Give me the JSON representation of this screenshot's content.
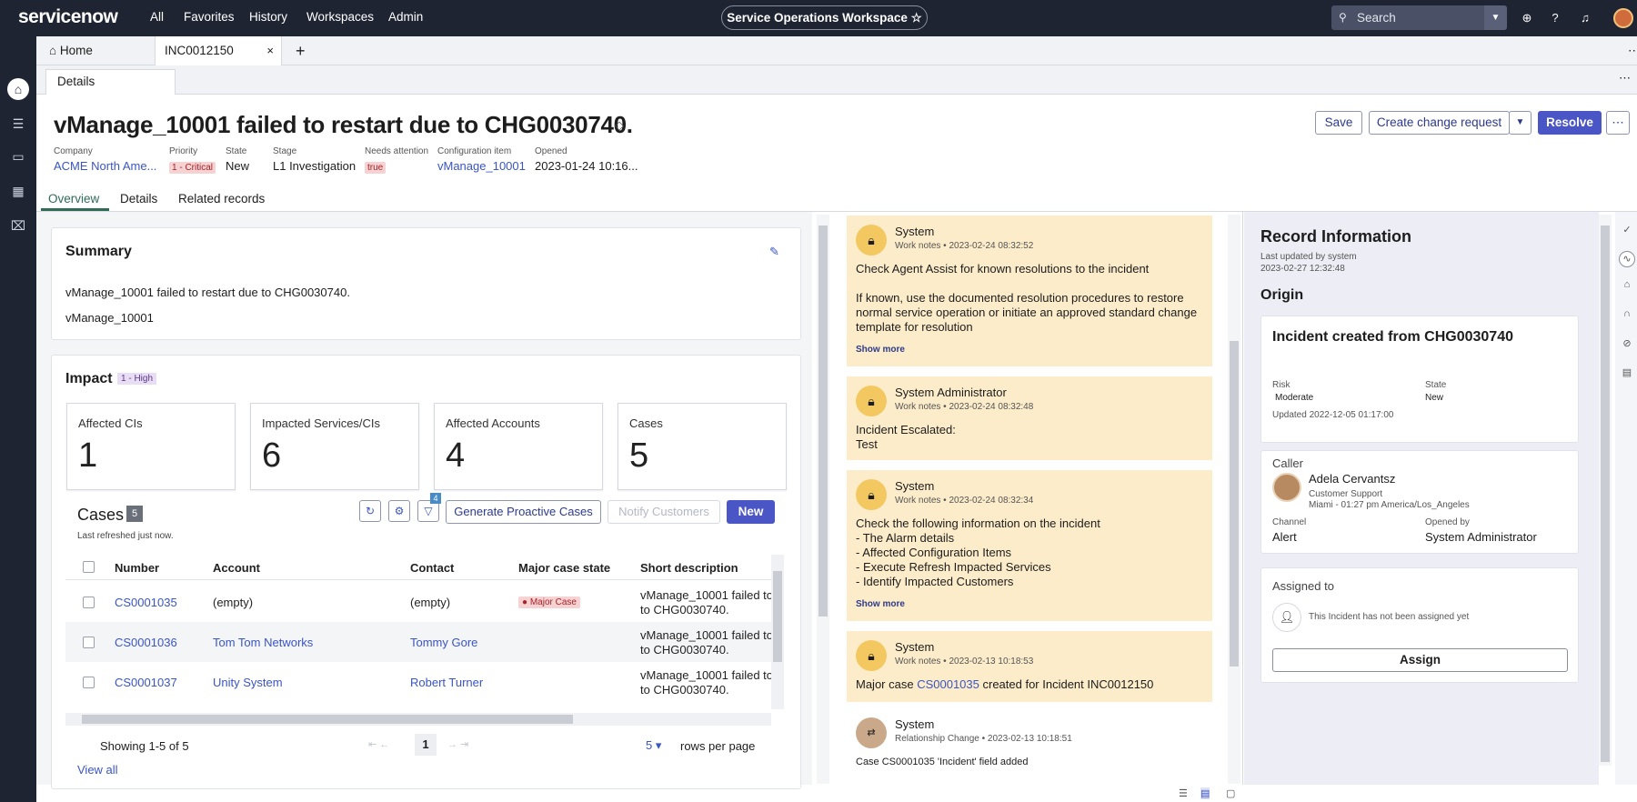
{
  "topnav": {
    "logo": "servicenow",
    "links": [
      "All",
      "Favorites",
      "History",
      "Workspaces",
      "Admin"
    ],
    "workspace": "Service Operations Workspace",
    "search_placeholder": "Search"
  },
  "tabs": {
    "home": "Home",
    "record": "INC0012150",
    "details": "Details"
  },
  "record": {
    "title": "vManage_10001 failed to restart due to CHG0030740.",
    "buttons": {
      "save": "Save",
      "create_change": "Create change request",
      "resolve": "Resolve"
    },
    "meta": {
      "company_label": "Company",
      "company": "ACME North Ame...",
      "priority_label": "Priority",
      "priority": "1 - Critical",
      "state_label": "State",
      "state": "New",
      "stage_label": "Stage",
      "stage": "L1 Investigation",
      "attention_label": "Needs attention",
      "attention": "true",
      "ci_label": "Configuration item",
      "ci": "vManage_10001",
      "opened_label": "Opened",
      "opened": "2023-01-24 10:16..."
    },
    "page_tabs": [
      "Overview",
      "Details",
      "Related records"
    ]
  },
  "summary": {
    "title": "Summary",
    "line1": "vManage_10001 failed to restart due to CHG0030740.",
    "line2": "vManage_10001"
  },
  "impact": {
    "title": "Impact",
    "badge": "1 - High",
    "metrics": [
      {
        "label": "Affected CIs",
        "value": "1"
      },
      {
        "label": "Impacted Services/CIs",
        "value": "6"
      },
      {
        "label": "Affected Accounts",
        "value": "4"
      },
      {
        "label": "Cases",
        "value": "5"
      }
    ]
  },
  "cases": {
    "title": "Cases",
    "count": "5",
    "refreshed": "Last refreshed just now.",
    "filter_count": "4",
    "generate_btn": "Generate Proactive Cases",
    "notify_btn": "Notify Customers",
    "new_btn": "New",
    "columns": [
      "Number",
      "Account",
      "Contact",
      "Major case state",
      "Short description"
    ],
    "rows": [
      {
        "number": "CS0001035",
        "account": "(empty)",
        "contact": "(empty)",
        "state": "Major Case",
        "desc1": "vManage_10001 failed to",
        "desc2": "to CHG0030740."
      },
      {
        "number": "CS0001036",
        "account": "Tom Tom Networks",
        "contact": "Tommy Gore",
        "state": "",
        "desc1": "vManage_10001 failed to",
        "desc2": "to CHG0030740."
      },
      {
        "number": "CS0001037",
        "account": "Unity System",
        "contact": "Robert Turner",
        "state": "",
        "desc1": "vManage_10001 failed to",
        "desc2": "to CHG0030740."
      }
    ],
    "showing": "Showing 1-5 of 5",
    "page": "1",
    "per_page": "5",
    "per_page_label": "rows per page",
    "view_all": "View all"
  },
  "activity": [
    {
      "name": "System",
      "type": "Work notes",
      "time": "2023-02-24 08:32:52",
      "body": [
        "Check Agent Assist for known resolutions to the incident",
        "",
        "If known, use the documented resolution procedures to restore",
        "normal service operation or initiate an approved standard change",
        "template for resolution"
      ],
      "more": "Show more"
    },
    {
      "name": "System Administrator",
      "type": "Work notes",
      "time": "2023-02-24 08:32:48",
      "body": [
        "Incident Escalated:",
        "Test"
      ]
    },
    {
      "name": "System",
      "type": "Work notes",
      "time": "2023-02-24 08:32:34",
      "body": [
        "Check the following information on the incident",
        "- The Alarm details",
        "- Affected Configuration Items",
        "- Execute Refresh Impacted Services",
        "- Identify Impacted Customers"
      ],
      "more": "Show more"
    },
    {
      "name": "System",
      "type": "Work notes",
      "time": "2023-02-13 10:18:53",
      "body_pre": "Major case ",
      "body_link": "CS0001035",
      "body_post": " created for Incident INC0012150"
    },
    {
      "name": "System",
      "type": "Relationship Change",
      "time": "2023-02-13 10:18:51",
      "body": [
        "Case CS0001035 'Incident' field added"
      ]
    }
  ],
  "record_info": {
    "title": "Record Information",
    "updated_by": "Last updated by system",
    "updated_at": "2023-02-27 12:32:48",
    "origin": "Origin",
    "origin_card": {
      "title": "Incident created from CHG0030740",
      "risk_label": "Risk",
      "risk": "Moderate",
      "state_label": "State",
      "state": "New",
      "updated": "Updated 2022-12-05 01:17:00"
    },
    "caller": {
      "label": "Caller",
      "name": "Adela Cervantsz",
      "dept": "Customer Support",
      "location": "Miami - 01:27 pm America/Los_Angeles",
      "channel_label": "Channel",
      "channel": "Alert",
      "opened_by_label": "Opened by",
      "opened_by": "System Administrator"
    },
    "assigned": {
      "label": "Assigned to",
      "none": "This Incident has not been assigned yet",
      "button": "Assign"
    }
  },
  "colors": {
    "nav": "#1f2433",
    "primary": "#4a56c6",
    "link": "#3a55c4",
    "activity_bg": "#fcecc9",
    "accent_green": "#2f6b55"
  }
}
